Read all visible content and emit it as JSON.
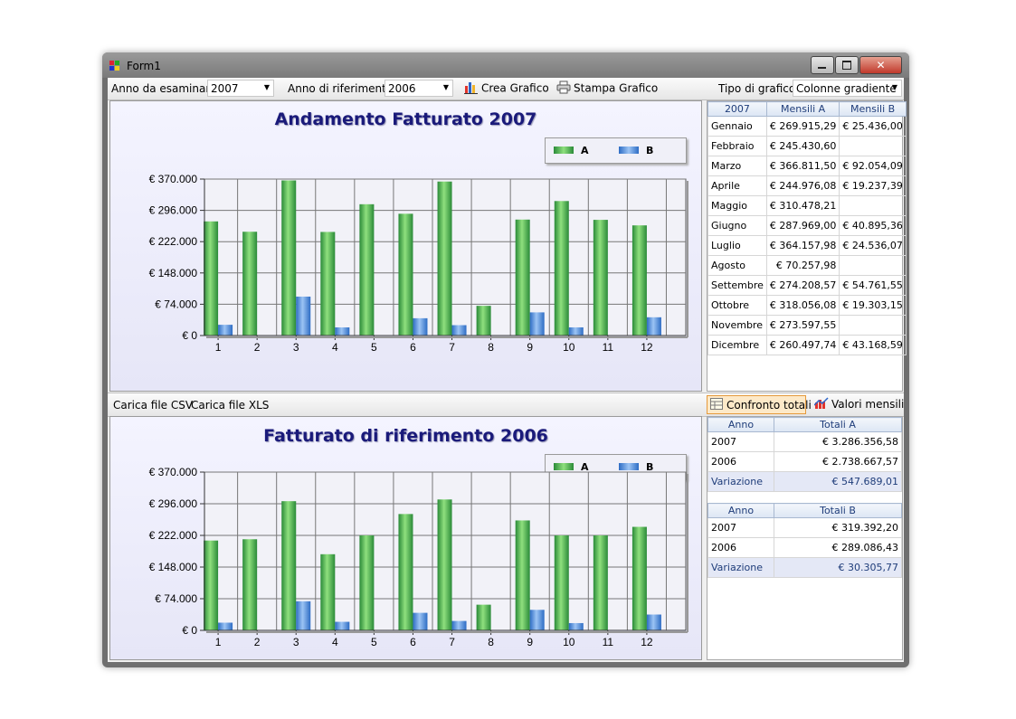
{
  "window": {
    "title": "Form1"
  },
  "toolbar": {
    "year_label": "Anno da esaminare",
    "year_value": "2007",
    "ref_label": "Anno di riferimento",
    "ref_value": "2006",
    "create_chart": "Crea Grafico",
    "print_chart": "Stampa Grafico",
    "chart_type_label": "Tipo di grafico",
    "chart_type_value": "Colonne gradiente"
  },
  "midbar": {
    "load_csv": "Carica file CSV",
    "load_xls": "Carica file XLS",
    "compare_totals": "Confronto totali",
    "monthly_values": "Valori mensili"
  },
  "colors": {
    "series_a": "#3fae4e",
    "series_b": "#4a8fe0",
    "title": "#1a1a7a"
  },
  "monthly_grid": {
    "headers": [
      "2007",
      "Mensili A",
      "Mensili B"
    ],
    "rows": [
      [
        "Gennaio",
        "€ 269.915,29",
        "€ 25.436,00"
      ],
      [
        "Febbraio",
        "€ 245.430,60",
        ""
      ],
      [
        "Marzo",
        "€ 366.811,50",
        "€ 92.054,09"
      ],
      [
        "Aprile",
        "€ 244.976,08",
        "€ 19.237,39"
      ],
      [
        "Maggio",
        "€ 310.478,21",
        ""
      ],
      [
        "Giugno",
        "€ 287.969,00",
        "€ 40.895,36"
      ],
      [
        "Luglio",
        "€ 364.157,98",
        "€ 24.536,07"
      ],
      [
        "Agosto",
        "€ 70.257,98",
        ""
      ],
      [
        "Settembre",
        "€ 274.208,57",
        "€ 54.761,55"
      ],
      [
        "Ottobre",
        "€ 318.056,08",
        "€ 19.303,15"
      ],
      [
        "Novembre",
        "€ 273.597,55",
        ""
      ],
      [
        "Dicembre",
        "€ 260.497,74",
        "€ 43.168,59"
      ]
    ]
  },
  "totals_a": {
    "headers": [
      "Anno",
      "Totali A"
    ],
    "rows": [
      [
        "2007",
        "€ 3.286.356,58"
      ],
      [
        "2006",
        "€ 2.738.667,57"
      ]
    ],
    "variation": [
      "Variazione",
      "€ 547.689,01"
    ]
  },
  "totals_b": {
    "headers": [
      "Anno",
      "Totali B"
    ],
    "rows": [
      [
        "2007",
        "€ 319.392,20"
      ],
      [
        "2006",
        "€ 289.086,43"
      ]
    ],
    "variation": [
      "Variazione",
      "€ 30.305,77"
    ]
  },
  "chart_data": [
    {
      "type": "bar",
      "title": "Andamento Fatturato 2007",
      "categories": [
        "1",
        "2",
        "3",
        "4",
        "5",
        "6",
        "7",
        "8",
        "9",
        "10",
        "11",
        "12"
      ],
      "yticks": [
        "€ 0",
        "€ 74.000",
        "€ 148.000",
        "€ 222.000",
        "€ 296.000",
        "€ 370.000"
      ],
      "ylim": [
        0,
        370000
      ],
      "grid": true,
      "legend": "top-right",
      "series": [
        {
          "name": "A",
          "values": [
            269915.29,
            245430.6,
            366811.5,
            244976.08,
            310478.21,
            287969.0,
            364157.98,
            70257.98,
            274208.57,
            318056.08,
            273597.55,
            260497.74
          ]
        },
        {
          "name": "B",
          "values": [
            25436.0,
            0,
            92054.09,
            19237.39,
            0,
            40895.36,
            24536.07,
            0,
            54761.55,
            19303.15,
            0,
            43168.59
          ]
        }
      ]
    },
    {
      "type": "bar",
      "title": "Fatturato di riferimento 2006",
      "categories": [
        "1",
        "2",
        "3",
        "4",
        "5",
        "6",
        "7",
        "8",
        "9",
        "10",
        "11",
        "12"
      ],
      "yticks": [
        "€ 0",
        "€ 74.000",
        "€ 148.000",
        "€ 222.000",
        "€ 296.000",
        "€ 370.000"
      ],
      "ylim": [
        0,
        370000
      ],
      "grid": true,
      "legend": "top-right",
      "series": [
        {
          "name": "A",
          "values": [
            210000,
            213000,
            302000,
            178000,
            222000,
            272000,
            306000,
            60000,
            257000,
            222000,
            222000,
            242000
          ]
        },
        {
          "name": "B",
          "values": [
            18000,
            0,
            68000,
            20000,
            0,
            41000,
            22000,
            0,
            48000,
            17000,
            0,
            37000
          ]
        }
      ]
    }
  ]
}
